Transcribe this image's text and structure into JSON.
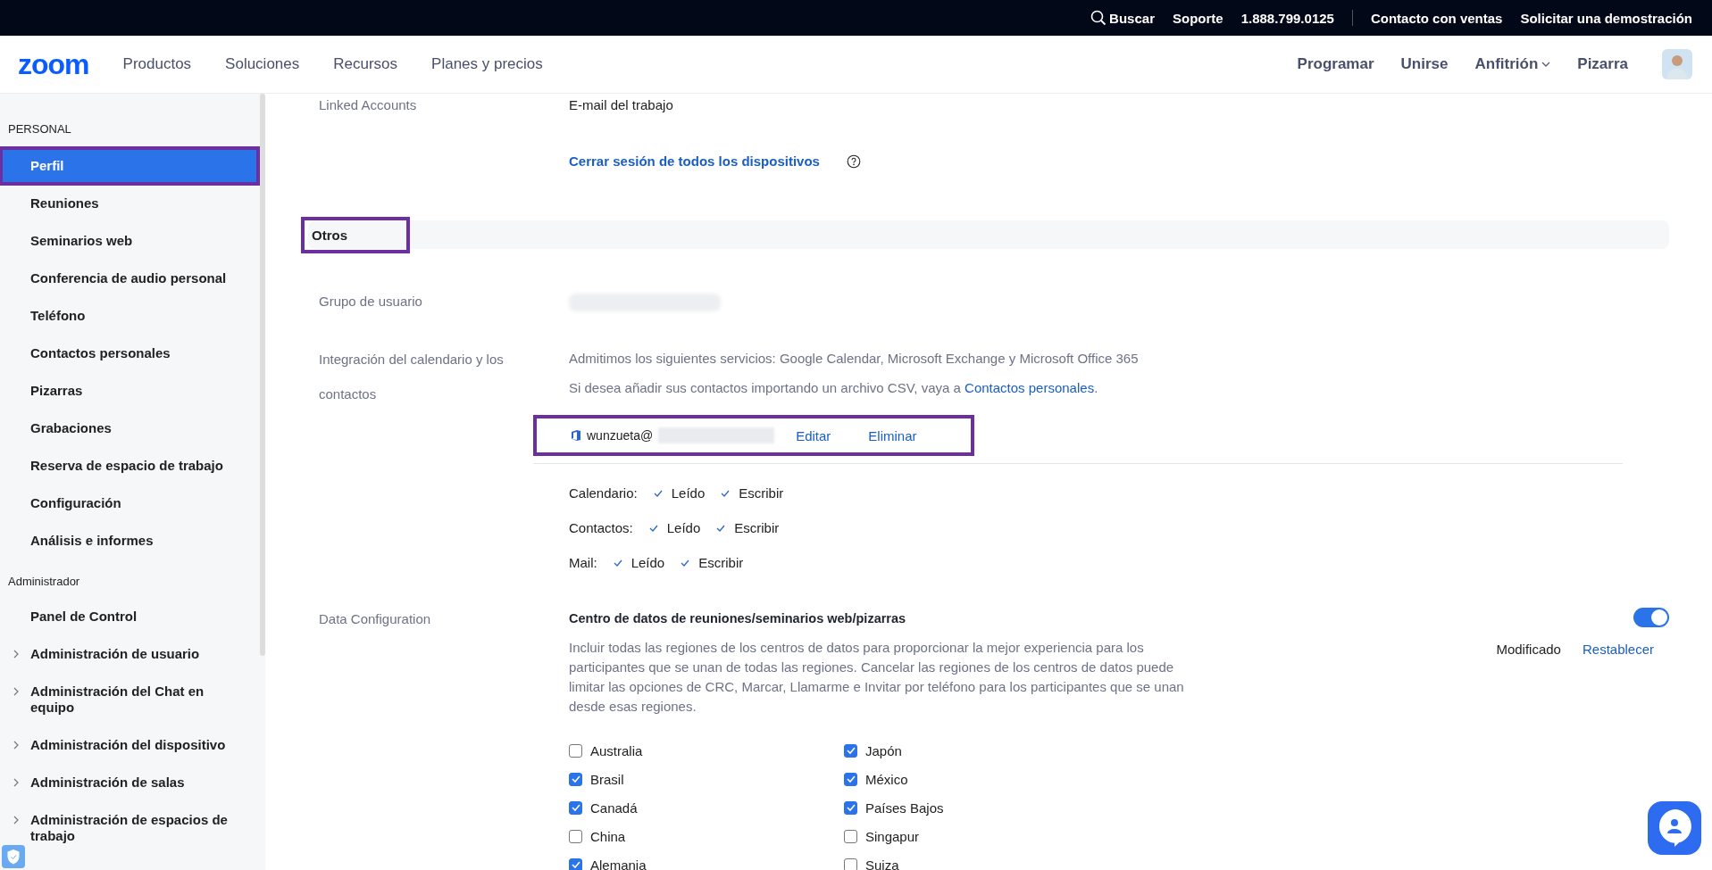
{
  "top_bar": {
    "search": "Buscar",
    "links": [
      "Soporte",
      "1.888.799.0125",
      "Contacto con ventas",
      "Solicitar una demostración"
    ]
  },
  "nav": {
    "logo": "zoom",
    "left": [
      "Productos",
      "Soluciones",
      "Recursos",
      "Planes y precios"
    ],
    "right": [
      {
        "label": "Programar",
        "dropdown": false
      },
      {
        "label": "Unirse",
        "dropdown": false
      },
      {
        "label": "Anfitrión",
        "dropdown": true
      },
      {
        "label": "Pizarra",
        "dropdown": false
      }
    ]
  },
  "sidebar": {
    "sections": [
      {
        "title": "PERSONAL",
        "items": [
          {
            "label": "Perfil",
            "selected": true,
            "highlighted": true,
            "expandable": false
          },
          {
            "label": "Reuniones",
            "selected": false,
            "highlighted": false,
            "expandable": false
          },
          {
            "label": "Seminarios web",
            "selected": false,
            "highlighted": false,
            "expandable": false
          },
          {
            "label": "Conferencia de audio personal",
            "selected": false,
            "highlighted": false,
            "expandable": false
          },
          {
            "label": "Teléfono",
            "selected": false,
            "highlighted": false,
            "expandable": false
          },
          {
            "label": "Contactos personales",
            "selected": false,
            "highlighted": false,
            "expandable": false
          },
          {
            "label": "Pizarras",
            "selected": false,
            "highlighted": false,
            "expandable": false
          },
          {
            "label": "Grabaciones",
            "selected": false,
            "highlighted": false,
            "expandable": false
          },
          {
            "label": "Reserva de espacio de trabajo",
            "selected": false,
            "highlighted": false,
            "expandable": false
          },
          {
            "label": "Configuración",
            "selected": false,
            "highlighted": false,
            "expandable": false
          },
          {
            "label": "Análisis e informes",
            "selected": false,
            "highlighted": false,
            "expandable": false
          }
        ]
      },
      {
        "title": "Administrador",
        "items": [
          {
            "label": "Panel de Control",
            "selected": false,
            "highlighted": false,
            "expandable": false
          },
          {
            "label": "Administración de usuario",
            "selected": false,
            "highlighted": false,
            "expandable": true
          },
          {
            "label": "Administración del Chat en equipo",
            "selected": false,
            "highlighted": false,
            "expandable": true
          },
          {
            "label": "Administración del dispositivo",
            "selected": false,
            "highlighted": false,
            "expandable": true
          },
          {
            "label": "Administración de salas",
            "selected": false,
            "highlighted": false,
            "expandable": true
          },
          {
            "label": "Administración de espacios de trabajo",
            "selected": false,
            "highlighted": false,
            "expandable": true
          }
        ]
      }
    ]
  },
  "linked_accounts": {
    "label": "Linked Accounts",
    "value": "E-mail del trabajo",
    "signout_link": "Cerrar sesión de todos los dispositivos"
  },
  "section": {
    "title": "Otros",
    "highlighted": true
  },
  "user_group": {
    "label": "Grupo de usuario"
  },
  "calendar_integration": {
    "label": "Integración del calendario y los contactos",
    "services": "Admitimos los siguientes servicios: Google Calendar, Microsoft Exchange y Microsoft Office 365",
    "csv_text": "Si desea añadir sus contactos importando un archivo CSV, vaya a",
    "csv_link": "Contactos personales",
    "csv_end": ".",
    "account": {
      "email": "wunzueta@",
      "edit": "Editar",
      "delete": "Eliminar",
      "highlighted": true
    },
    "permissions": [
      {
        "label": "Calendario:",
        "items": [
          {
            "label": "Leído",
            "checked": true
          },
          {
            "label": "Escribir",
            "checked": true
          }
        ]
      },
      {
        "label": "Contactos:",
        "items": [
          {
            "label": "Leído",
            "checked": true
          },
          {
            "label": "Escribir",
            "checked": true
          }
        ]
      },
      {
        "label": "Mail:",
        "items": [
          {
            "label": "Leído",
            "checked": true
          },
          {
            "label": "Escribir",
            "checked": true
          }
        ]
      }
    ]
  },
  "data_configuration": {
    "label": "Data Configuration",
    "title": "Centro de datos de reuniones/seminarios web/pizarras",
    "on": true,
    "description": "Incluir todas las regiones de los centros de datos para proporcionar la mejor experiencia para los participantes que se unan de todas las regiones. Cancelar las regiones de los centros de datos puede limitar las opciones de CRC, Marcar, Llamarme e Invitar por teléfono para los participantes que se unan desde esas regiones.",
    "status": "Modificado",
    "reset": "Restablecer",
    "regions": [
      {
        "label": "Australia",
        "checked": false
      },
      {
        "label": "Brasil",
        "checked": true
      },
      {
        "label": "Canadá",
        "checked": true
      },
      {
        "label": "China",
        "checked": false
      },
      {
        "label": "Alemania",
        "checked": true
      },
      {
        "label": "Japón",
        "checked": true
      },
      {
        "label": "México",
        "checked": true
      },
      {
        "label": "Países Bajos",
        "checked": true
      },
      {
        "label": "Singapur",
        "checked": false
      },
      {
        "label": "Suiza",
        "checked": false
      }
    ]
  }
}
